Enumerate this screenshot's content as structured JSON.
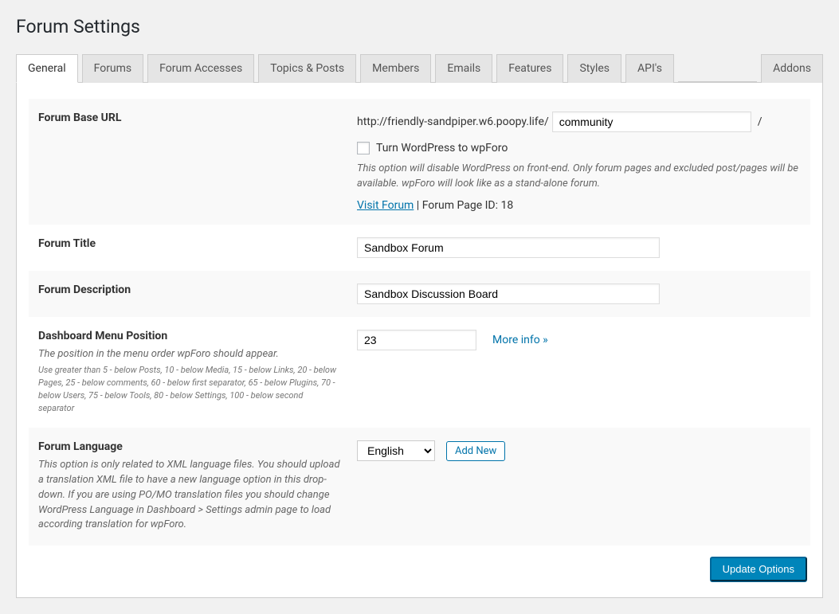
{
  "page": {
    "title": "Forum Settings"
  },
  "tabs": {
    "general": "General",
    "forums": "Forums",
    "accesses": "Forum Accesses",
    "topics": "Topics & Posts",
    "members": "Members",
    "emails": "Emails",
    "features": "Features",
    "styles": "Styles",
    "apis": "API's",
    "addons": "Addons"
  },
  "base_url": {
    "label": "Forum Base URL",
    "prefix": "http://friendly-sandpiper.w6.poopy.life/",
    "slug": "community",
    "suffix": "/",
    "turn_label": "Turn WordPress to wpForo",
    "help": "This option will disable WordPress on front-end. Only forum pages and excluded post/pages will be available. wpForo will look like as a stand-alone forum.",
    "visit": "Visit Forum",
    "page_id": " | Forum Page ID: 18"
  },
  "title": {
    "label": "Forum Title",
    "value": "Sandbox Forum"
  },
  "desc": {
    "label": "Forum Description",
    "value": "Sandbox Discussion Board"
  },
  "menu": {
    "label": "Dashboard Menu Position",
    "value": "23",
    "more": "More info »",
    "desc": "The position in the menu order wpForo should appear.",
    "note": "Use greater than 5 - below Posts, 10 - below Media, 15 - below Links, 20 - below Pages, 25 - below comments, 60 - below first separator, 65 - below Plugins, 70 - below Users, 75 - below Tools, 80 - below Settings, 100 - below second separator"
  },
  "lang": {
    "label": "Forum Language",
    "value": "English",
    "add": "Add New",
    "desc": "This option is only related to XML language files. You should upload a translation XML file to have a new language option in this drop-down. If you are using PO/MO translation files you should change WordPress Language in Dashboard > Settings admin page to load according translation for wpForo."
  },
  "footer": {
    "update": "Update Options"
  }
}
